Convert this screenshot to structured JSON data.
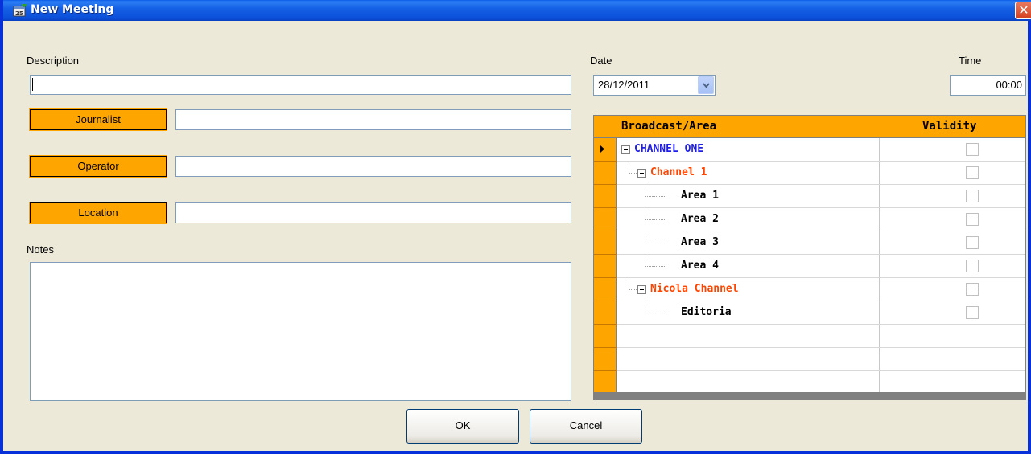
{
  "window": {
    "title": "New Meeting",
    "close_glyph": "✕",
    "icon": "calendar-add-icon"
  },
  "form": {
    "description_label": "Description",
    "description_value": "",
    "journalist_button": "Journalist",
    "journalist_value": "",
    "operator_button": "Operator",
    "operator_value": "",
    "location_button": "Location",
    "location_value": "",
    "notes_label": "Notes",
    "notes_value": "",
    "date_label": "Date",
    "date_value": "28/12/2011",
    "time_label": "Time",
    "time_value": "00:00"
  },
  "grid": {
    "headers": [
      "Broadcast/Area",
      "Validity"
    ],
    "rows": [
      {
        "label": "CHANNEL ONE",
        "color": "#1e1ee6",
        "checked": false
      },
      {
        "label": "Channel 1",
        "color": "#ff4500",
        "checked": false
      },
      {
        "label": "Area 1",
        "color": "#000000",
        "checked": false
      },
      {
        "label": "Area 2",
        "color": "#000000",
        "checked": false
      },
      {
        "label": "Area 3",
        "color": "#000000",
        "checked": false
      },
      {
        "label": "Area 4",
        "color": "#000000",
        "checked": false
      },
      {
        "label": "Nicola Channel",
        "color": "#ff4500",
        "checked": false
      },
      {
        "label": "Editoria",
        "color": "#000000",
        "checked": false
      }
    ]
  },
  "buttons": {
    "ok": "OK",
    "cancel": "Cancel"
  },
  "colors": {
    "accent_orange": "#ffa500",
    "titlebar_blue": "#0a5ae8"
  }
}
